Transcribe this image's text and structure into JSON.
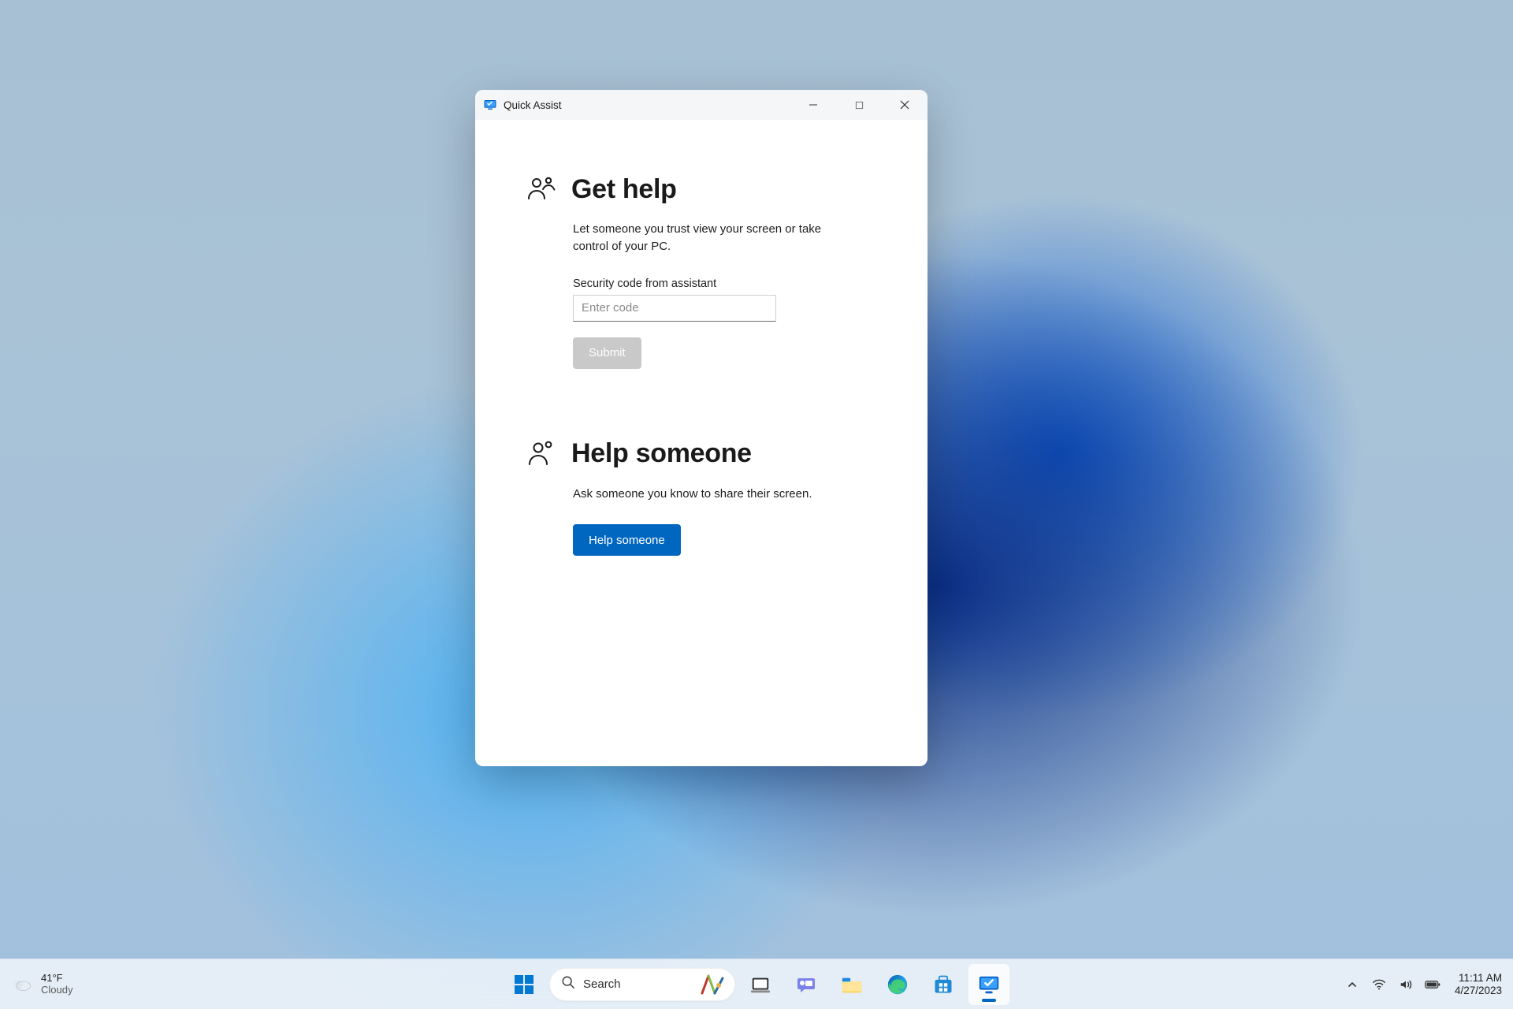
{
  "window": {
    "title": "Quick Assist",
    "get_help": {
      "title": "Get help",
      "description": "Let someone you trust view your screen or take control of your PC.",
      "field_label": "Security code from assistant",
      "placeholder": "Enter code",
      "submit_label": "Submit"
    },
    "help_someone": {
      "title": "Help someone",
      "description": "Ask someone you know to share their screen.",
      "button_label": "Help someone"
    }
  },
  "taskbar": {
    "weather": {
      "temp": "41°F",
      "condition": "Cloudy"
    },
    "search_placeholder": "Search",
    "clock": {
      "time": "11:11 AM",
      "date": "4/27/2023"
    }
  }
}
